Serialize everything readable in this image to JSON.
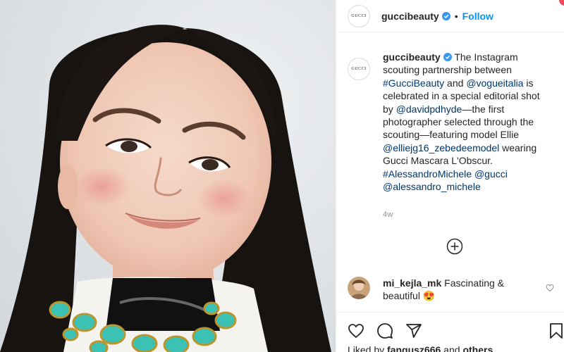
{
  "post": {
    "username": "guccibeauty",
    "follow_label": "Follow",
    "separator": "•",
    "avatar_text": "GUCCI"
  },
  "caption": {
    "username": "guccibeauty",
    "segments": [
      {
        "text": " The Instagram scouting partnership between ",
        "type": "text"
      },
      {
        "text": "#GucciBeauty",
        "type": "link"
      },
      {
        "text": " and ",
        "type": "text"
      },
      {
        "text": "@vogueitalia",
        "type": "link"
      },
      {
        "text": " is celebrated in a special editorial shot by ",
        "type": "text"
      },
      {
        "text": "@davidpdhyde",
        "type": "link"
      },
      {
        "text": "—the first photographer selected through the scouting—featuring model Ellie ",
        "type": "text"
      },
      {
        "text": "@elliejg16_zebedeemodel",
        "type": "link"
      },
      {
        "text": " wearing Gucci Mascara L'Obscur. ",
        "type": "text"
      },
      {
        "text": "#AlessandroMichele",
        "type": "link"
      },
      {
        "text": " ",
        "type": "text"
      },
      {
        "text": "@gucci",
        "type": "link"
      },
      {
        "text": " ",
        "type": "text"
      },
      {
        "text": "@alessandro_michele",
        "type": "link"
      }
    ],
    "timestamp": "4w"
  },
  "comment": {
    "username": "mi_kejla_mk",
    "text": " Fascinating & beautiful 😍"
  },
  "likes": {
    "prefix": "Liked by ",
    "user": "fangusz666",
    "middle": " and ",
    "others": "others"
  },
  "icons": {
    "verified": "verified-badge-icon",
    "more": "plus-circle-icon",
    "like": "heart-icon",
    "comment": "comment-bubble-icon",
    "share": "paper-plane-icon",
    "save": "bookmark-icon"
  },
  "colors": {
    "link": "#00376b",
    "follow": "#0095f6",
    "verified": "#3897f0",
    "muted": "#8e8e8e"
  }
}
